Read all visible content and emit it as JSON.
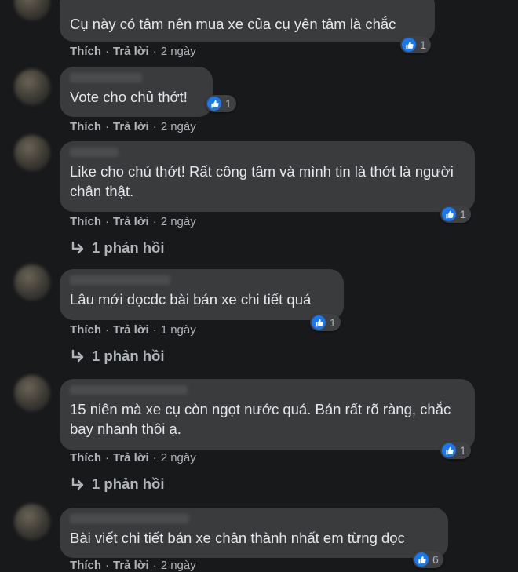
{
  "comments": [
    {
      "text": "Cụ này có tâm nên mua xe của cụ yên tâm là chắc",
      "reactions": "1",
      "like": "Thích",
      "reply": "Trả lời",
      "time": "2 ngày"
    },
    {
      "text": "Vote cho chủ thớt!",
      "reactions": "1",
      "like": "Thích",
      "reply": "Trả lời",
      "time": "2 ngày"
    },
    {
      "text": "Like cho chủ thớt! Rất công tâm và mình tin là thớt là người chân thật.",
      "reactions": "1",
      "like": "Thích",
      "reply": "Trả lời",
      "time": "2 ngày",
      "replies": "1 phản hồi"
    },
    {
      "text": "Lâu mới dọcdc bài bán xe chi tiết quá",
      "reactions": "1",
      "like": "Thích",
      "reply": "Trả lời",
      "time": "1 ngày",
      "replies": "1 phản hồi"
    },
    {
      "text": "15 niên mà xe cụ còn ngọt nước quá. Bán rất rõ ràng, chắc bay nhanh thôi ạ.",
      "reactions": "1",
      "like": "Thích",
      "reply": "Trả lời",
      "time": "2 ngày",
      "replies": "1 phản hồi"
    },
    {
      "text": "Bài viết chi tiết bán xe chân thành nhất em từng đọc",
      "reactions": "6",
      "like": "Thích",
      "reply": "Trả lời",
      "time": "2 ngày"
    }
  ],
  "separator": "·",
  "reply_arrow_icon": "reply-arrow-icon",
  "like_icon": "thumbs-up-icon",
  "colors": {
    "background": "#18191a",
    "bubble": "#3a3b3c",
    "meta": "#b0b3b8",
    "like_blue": "#1877f2"
  }
}
